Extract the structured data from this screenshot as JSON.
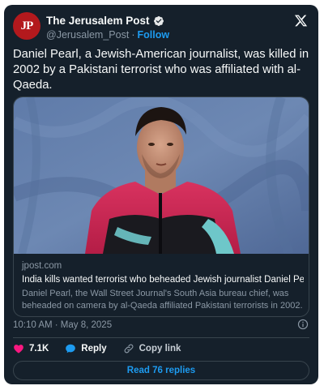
{
  "author": {
    "avatar_text": "JP",
    "display_name": "The Jerusalem Post",
    "handle": "@Jerusalem_Post",
    "separator": "·",
    "follow_label": "Follow"
  },
  "tweet": {
    "text": "Daniel Pearl, a Jewish-American journalist, was killed in 2002 by a Pakistani terrorist who was affiliated with al-Qaeda.",
    "timestamp": "10:10 AM · May 8, 2025"
  },
  "link_card": {
    "domain": "jpost.com",
    "title": "India kills wanted terrorist who beheaded Jewish journalist Daniel Pearl",
    "description": "Daniel Pearl, the Wall Street Journal's South Asia bureau chief, was beheaded on camera by al-Qaeda affiliated Pakistani terrorists in 2002."
  },
  "actions": {
    "like_count": "7.1K",
    "reply_label": "Reply",
    "copy_link_label": "Copy link"
  },
  "read_replies_label": "Read 76 replies",
  "icons": {
    "verified": "verified-badge-icon",
    "brand": "x-logo-icon",
    "info": "info-icon",
    "like": "heart-icon",
    "reply": "speech-bubble-icon",
    "copy": "link-icon"
  },
  "colors": {
    "background": "#15202b",
    "accent": "#1d9bf0",
    "like": "#f91880",
    "avatar": "#b3191d",
    "muted_text": "#8b98a5",
    "border": "#38444d"
  }
}
